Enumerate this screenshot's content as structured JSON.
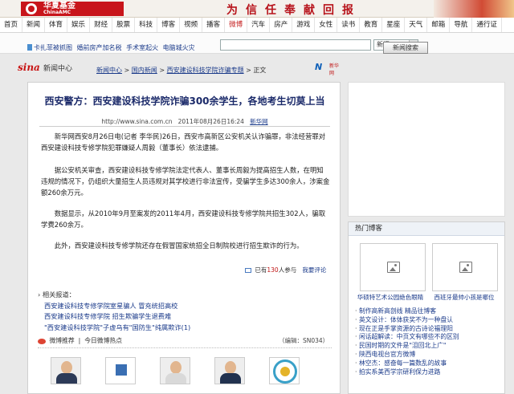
{
  "banner": {
    "brand": "华夏基金",
    "brand_sub": "ChinaAMC",
    "slogan": "为信任奉献回报"
  },
  "nav": [
    {
      "label": "首页",
      "hot": false
    },
    {
      "label": "新闻",
      "hot": false
    },
    {
      "label": "体育",
      "hot": false
    },
    {
      "label": "娱乐",
      "hot": false
    },
    {
      "label": "财经",
      "hot": false
    },
    {
      "label": "股票",
      "hot": false
    },
    {
      "label": "科技",
      "hot": false
    },
    {
      "label": "博客",
      "hot": false
    },
    {
      "label": "视频",
      "hot": false
    },
    {
      "label": "播客",
      "hot": false
    },
    {
      "label": "微博",
      "hot": true
    },
    {
      "label": "汽车",
      "hot": false
    },
    {
      "label": "房产",
      "hot": false
    },
    {
      "label": "游戏",
      "hot": false
    },
    {
      "label": "女性",
      "hot": false
    },
    {
      "label": "读书",
      "hot": false
    },
    {
      "label": "教育",
      "hot": false
    },
    {
      "label": "星座",
      "hot": false
    },
    {
      "label": "天气",
      "hot": false
    },
    {
      "label": "邮箱",
      "hot": false
    },
    {
      "label": "导航",
      "hot": false
    },
    {
      "label": "通行证",
      "hot": false
    }
  ],
  "ad_links": {
    "line1": "卡扎菲被抓图",
    "line1b": "婚前房产加名税",
    "line1c": "手术室起火",
    "line1d": "电脑城火灾"
  },
  "search": {
    "select_value": "新闻",
    "button_label": "新闻搜索"
  },
  "header": {
    "logo": "sina",
    "logo_sub": "新闻中心",
    "crumbs": [
      "新闻中心",
      "国内新闻",
      "西安建设科技学院诈骗专题"
    ],
    "crumb_tail": "正文",
    "partner": "新华网"
  },
  "article": {
    "title": "西安警方：西安建设科技学院诈骗300余学生，各地考生切莫上当",
    "meta_site": "http://www.sina.com.cn",
    "meta_time": "2011年08月26日16:24",
    "meta_source": "新华网",
    "paragraphs": [
      "新华网西安8月26日电(记者 李华民)26日，西安市高新区公安机关认诈骗罪，非法经营罪对西安建设科技专修学院犯罪嫌疑人周毅（董事长）依法逮捕。",
      "据公安机关审查，西安建设科技专修学院法定代表人、董事长周毅为提高招生人数，在明知违规的情况下，仍组织大量招生人员违规对其学校进行非法宣传，受骗学生多达300余人，涉案金额260余万元。",
      "数据显示，从2010年9月至案发的2011年4月，西安建设科技专修学院共招生302人，骗取学费260余万。",
      "此外，西安建设科技专修学院还存在假冒国家统招全日制院校进行招生欺诈的行为。"
    ],
    "comment_prefix": "已有",
    "comment_count": "130",
    "comment_suffix": "人参与",
    "comment_link": "我要评论",
    "related_head": "相关报道：",
    "related": [
      "西安建设科技专修学院室星骗人 冒充统招高校",
      "西安建设科技专修学院 招生欺骗学生退费难",
      "\"西安建设科技学院\"子虚乌有\"国防生\"纯属欺诈(1)"
    ],
    "weibo_label": "微博推荐",
    "weibo_hot": "今日微博热点",
    "editor": "（编辑：SN034）"
  },
  "sidebar": {
    "head": "热门博客",
    "photos": [
      {
        "caption": "华硕特艺术公园绝色眼睛"
      },
      {
        "caption": "西班牙最帅小孩是哪位"
      }
    ],
    "blogs": [
      "制作高新高剖线 精品往博客",
      "英文设计：体体获奖不为一种盘认",
      "现在正是手掌资源的古诗论福理阳",
      "闲话超解读：中页文有哪些不的区别",
      "民国时期的文件是\"沮回北上广\"",
      "陕西电视台官方微博",
      "林空杰：感奋每一篇数乱的故事",
      "拍实系美西学宗研利保力进路"
    ]
  },
  "colors": {
    "accent_red": "#c8151b",
    "link_blue": "#1a3a8a",
    "title_blue": "#1b2a6a"
  }
}
